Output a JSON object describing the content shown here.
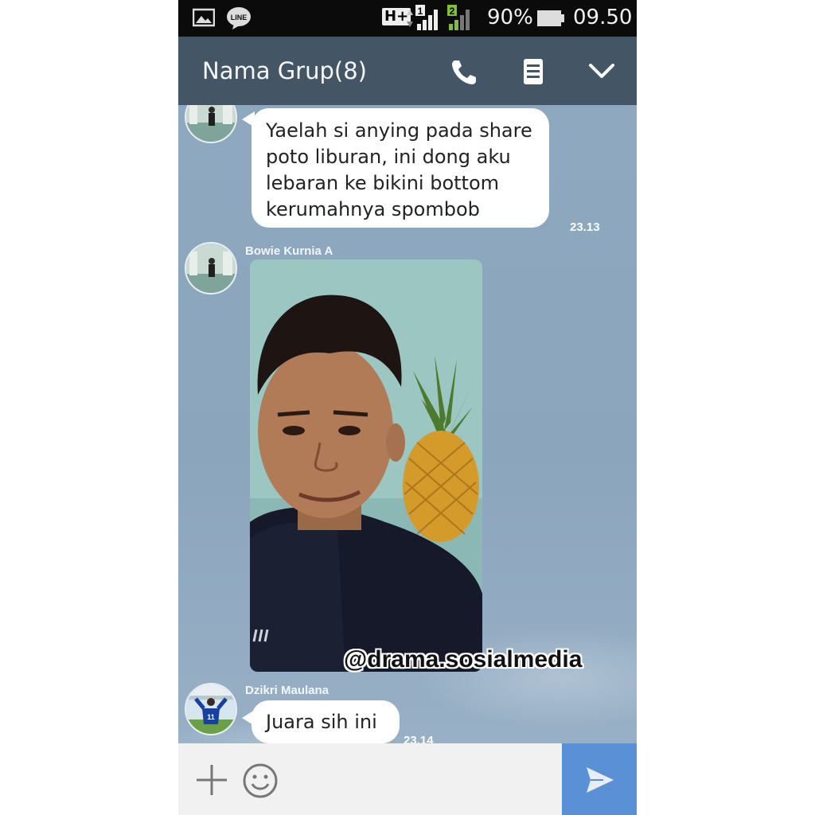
{
  "status_bar": {
    "network": "H+",
    "sim1": "1",
    "sim2": "2",
    "battery": "90%",
    "time": "09.50",
    "icons": [
      "gallery-icon",
      "line-app-icon",
      "signal-icon",
      "battery-icon"
    ]
  },
  "header": {
    "title": "Nama Grup(8)",
    "icons": [
      "phone-icon",
      "notes-icon",
      "chevron-down-icon"
    ]
  },
  "messages": [
    {
      "type": "text",
      "lines": [
        "Yaelah si anying pada share",
        "poto liburan, ini dong aku",
        "lebaran ke bikini bottom",
        "kerumahnya spombob"
      ],
      "time": "23.13"
    },
    {
      "type": "image",
      "sender": "Bowie Kurnia A",
      "description": ""
    },
    {
      "type": "text",
      "sender": "Dzikri Maulana",
      "text": "Juara sih ini",
      "time": "23.14"
    }
  ],
  "watermark": "@drama.sosialmedia",
  "input": {
    "icons": [
      "plus-icon",
      "emoji-icon",
      "send-icon"
    ]
  },
  "colors": {
    "header_bg": "#445566",
    "chat_bg": "#8ea8c0",
    "send_button": "#5a90d6"
  }
}
